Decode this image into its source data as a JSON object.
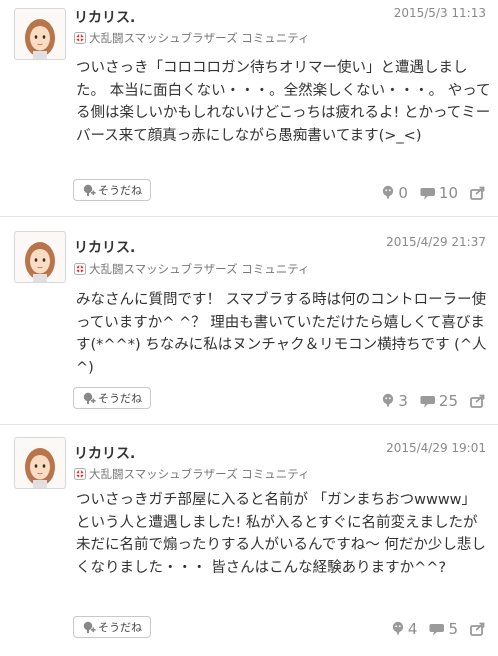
{
  "posts": [
    {
      "username": "リカリス.",
      "community": "大乱闘スマッシュブラザーズ コミュニティ",
      "timestamp": "2015/5/3 11:13",
      "body": "ついさっき「コロコロガン待ちオリマー使い」と遭遇しました。 本当に面白くない・・・。全然楽しくない・・・。 やってる側は楽しいかもしれないけどこっちは疲れるよ! とかってミーバース来て顔真っ赤にしながら愚痴書いてます(>_<)",
      "yeah_label": "そうだね",
      "yeah_count": "0",
      "comment_count": "10"
    },
    {
      "username": "リカリス.",
      "community": "大乱闘スマッシュブラザーズ コミュニティ",
      "timestamp": "2015/4/29 21:37",
      "body": "みなさんに質問です！ スマブラする時は何のコントローラー使っていますか^ ^？ 理由も書いていただけたら嬉しくて喜びます(*^^*) ちなみに私はヌンチャク＆リモコン横持ちです (^人^)",
      "yeah_label": "そうだね",
      "yeah_count": "3",
      "comment_count": "25"
    },
    {
      "username": "リカリス.",
      "community": "大乱闘スマッシュブラザーズ コミュニティ",
      "timestamp": "2015/4/29 19:01",
      "body": "ついさっきガチ部屋に入ると名前が 「ガンまちおつwwww」 という人と遭遇しました! 私が入るとすぐに名前変えましたが未だに名前で煽ったりする人がいるんですね～ 何だか少し悲しくなりました・・・ 皆さんはこんな経験ありますか^^?",
      "yeah_label": "そうだね",
      "yeah_count": "4",
      "comment_count": "5"
    }
  ],
  "icons": {
    "avatar": "mii-avatar-icon",
    "community": "smash-bros-icon",
    "yeah": "yeah-smile-icon",
    "comment": "comment-icon",
    "share": "share-icon"
  }
}
